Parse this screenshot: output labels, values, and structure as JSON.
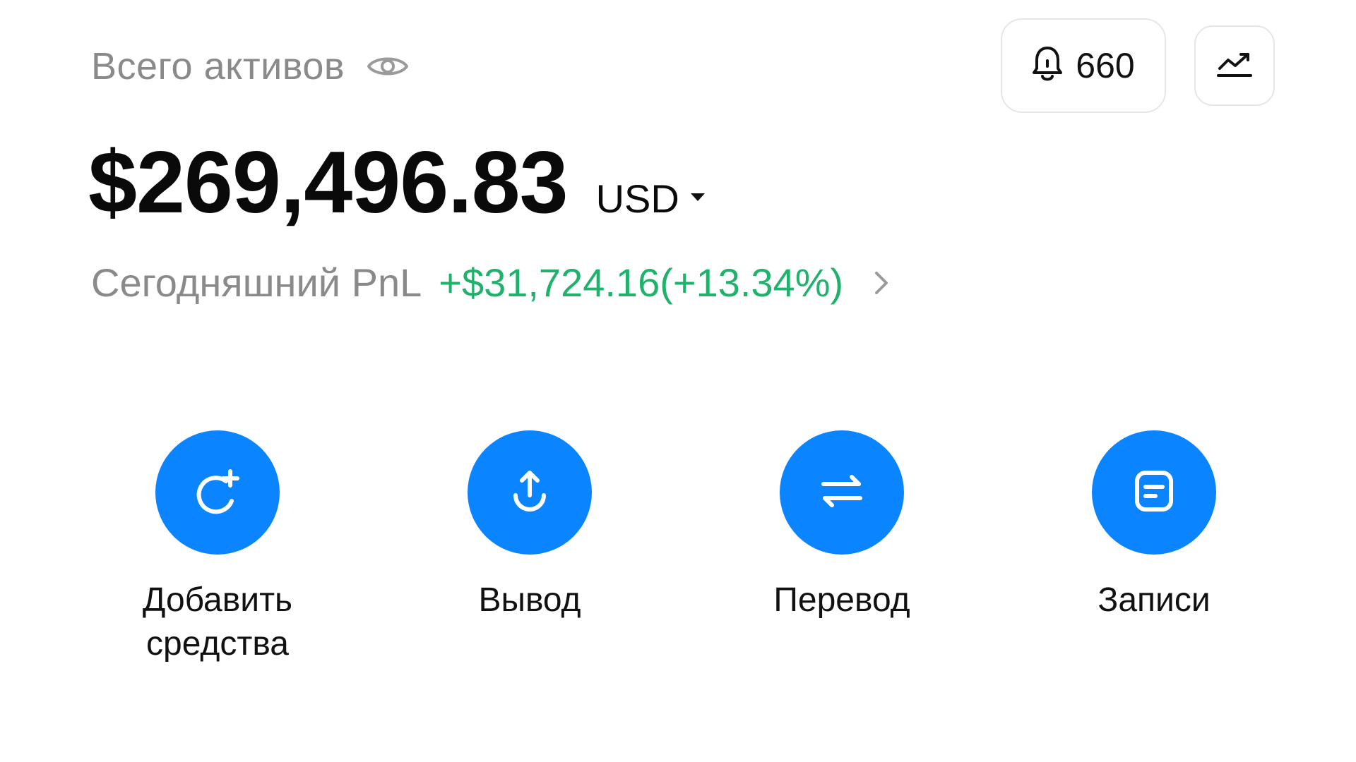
{
  "header": {
    "assets_label": "Всего активов",
    "eye_icon": "eye-icon",
    "notification_count": "660",
    "bell_icon": "bell-icon",
    "chart_icon": "chart-trend-icon"
  },
  "balance": {
    "amount": "$269,496.83",
    "currency": "USD",
    "currency_dropdown_icon": "caret-down-icon"
  },
  "pnl": {
    "label": "Сегодняшний PnL",
    "value": "+$31,724.16(+13.34%)",
    "chevron_icon": "chevron-right-icon"
  },
  "actions": [
    {
      "id": "deposit",
      "label": "Добавить\nсредства",
      "icon": "add-funds-icon"
    },
    {
      "id": "withdraw",
      "label": "Вывод",
      "icon": "upload-icon"
    },
    {
      "id": "transfer",
      "label": "Перевод",
      "icon": "transfer-icon"
    },
    {
      "id": "records",
      "label": "Записи",
      "icon": "records-icon"
    }
  ],
  "colors": {
    "accent": "#0a84ff",
    "positive": "#20b26c",
    "muted": "#8a8a8a",
    "text": "#0a0a0a"
  }
}
